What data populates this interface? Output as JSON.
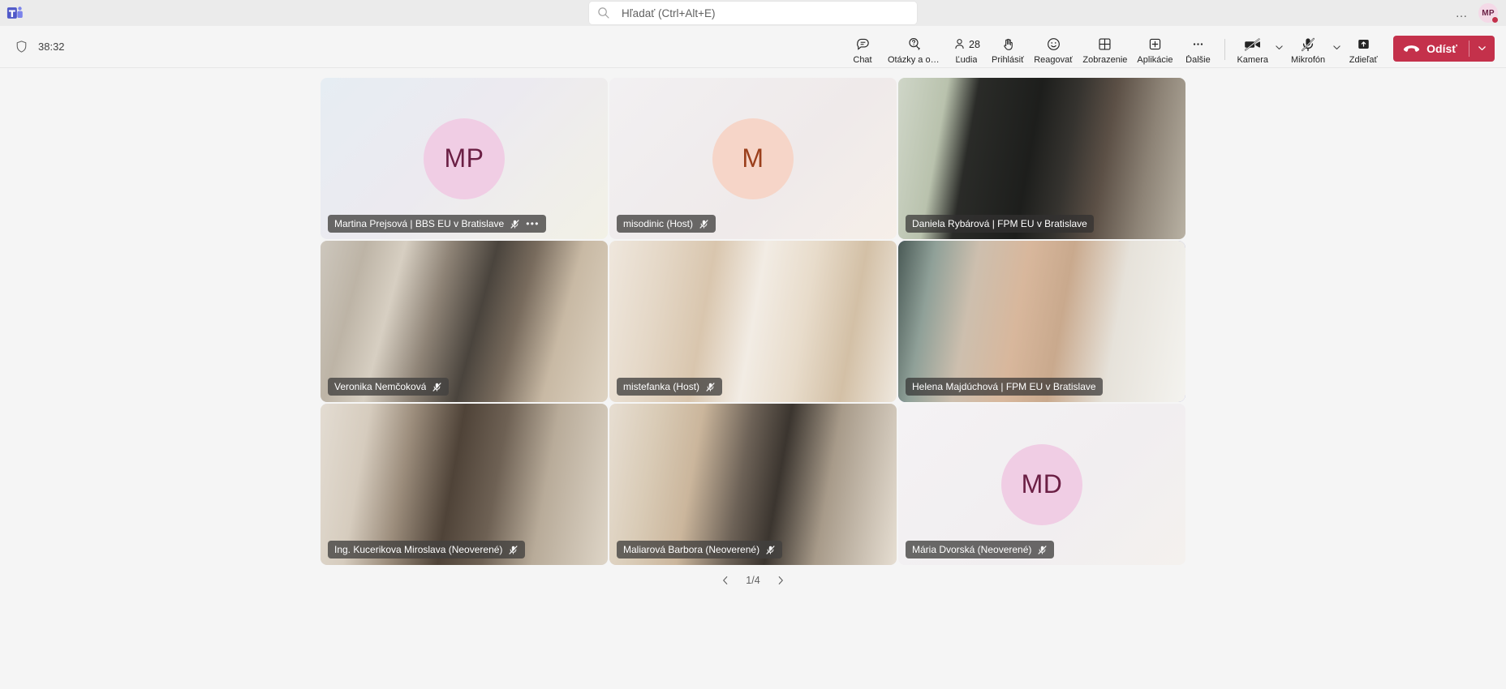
{
  "titlebar": {
    "app_logo": "teams-logo",
    "search": {
      "placeholder": "Hľadať (Ctrl+Alt+E)",
      "value": ""
    },
    "more_label": "…",
    "account": {
      "initials": "MP",
      "presence": "busy",
      "presence_color": "#c4314b"
    }
  },
  "meetingbar": {
    "shield_icon": "shield-icon",
    "timer": "38:32",
    "controls": [
      {
        "label": "Chat",
        "icon": "chat-icon"
      },
      {
        "label": "Otázky a od...",
        "icon": "question-answer-icon"
      },
      {
        "label": "Ľudia",
        "icon": "people-icon",
        "count": "28"
      },
      {
        "label": "Prihlásiť",
        "icon": "raise-hand-icon"
      },
      {
        "label": "Reagovať",
        "icon": "emoji-icon"
      },
      {
        "label": "Zobrazenie",
        "icon": "grid-view-icon"
      },
      {
        "label": "Aplikácie",
        "icon": "apps-plus-icon"
      },
      {
        "label": "Ďalšie",
        "icon": "more-horizontal-icon"
      }
    ],
    "camera": {
      "label": "Kamera",
      "icon": "camera-off-icon",
      "state": "off"
    },
    "microphone": {
      "label": "Mikrofón",
      "icon": "mic-off-icon",
      "state": "muted"
    },
    "share": {
      "label": "Zdieľať",
      "icon": "share-screen-icon"
    },
    "leave": {
      "label": "Odísť",
      "icon": "hangup-icon",
      "color": "#c4314b"
    }
  },
  "stage": {
    "participants": [
      {
        "name": "Martina Prejsová | BBS EU v Bratislave",
        "kind": "avatar",
        "initials": "MP",
        "avatar_bg": "#f0cde4",
        "avatar_fg": "#6b1f44",
        "muted": true,
        "has_more": true,
        "active": false
      },
      {
        "name": "misodinic (Host)",
        "kind": "avatar",
        "initials": "M",
        "avatar_bg": "#f6d5c8",
        "avatar_fg": "#9b3f1c",
        "muted": true,
        "has_more": false,
        "active": false
      },
      {
        "name": "Daniela Rybárová | FPM EU v Bratislave",
        "kind": "video",
        "video": "office-plant-dark",
        "muted": false,
        "has_more": false,
        "active": false
      },
      {
        "name": "Veronika Nemčoková",
        "kind": "video",
        "video": "office-shelves",
        "muted": true,
        "has_more": false,
        "active": false
      },
      {
        "name": "mistefanka (Host)",
        "kind": "video",
        "video": "bright-room",
        "muted": true,
        "has_more": false,
        "active": false
      },
      {
        "name": "Helena Majdúchová | FPM EU v Bratislave",
        "kind": "video",
        "video": "window-light",
        "muted": false,
        "has_more": false,
        "active": true
      },
      {
        "name": "Ing. Kucerikova Miroslava (Neoverené)",
        "kind": "video",
        "video": "living-room",
        "muted": true,
        "has_more": false,
        "active": false
      },
      {
        "name": "Maliarová Barbora (Neoverené)",
        "kind": "video",
        "video": "bright-room-2",
        "muted": true,
        "has_more": false,
        "active": false
      },
      {
        "name": "Mária Dvorská (Neoverené)",
        "kind": "avatar",
        "initials": "MD",
        "avatar_bg": "#f0cde4",
        "avatar_fg": "#6b1f44",
        "muted": true,
        "has_more": false,
        "active": false
      }
    ],
    "pagination": {
      "prev": "‹",
      "label": "1/4",
      "next": "›"
    }
  }
}
